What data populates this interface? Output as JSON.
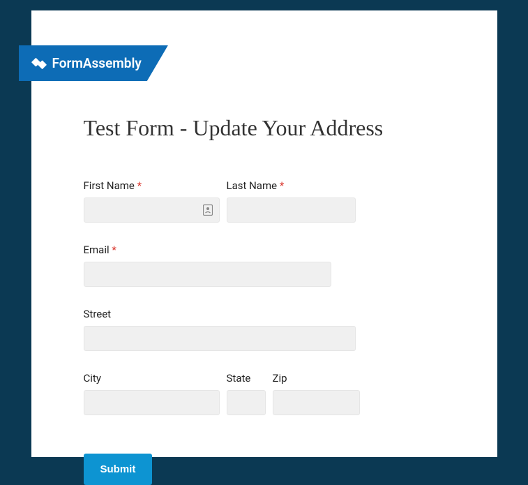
{
  "brand": {
    "name": "FormAssembly"
  },
  "title": "Test Form - Update Your Address",
  "fields": {
    "first_name": {
      "label": "First Name",
      "required": true
    },
    "last_name": {
      "label": "Last Name",
      "required": true
    },
    "email": {
      "label": "Email",
      "required": true
    },
    "street": {
      "label": "Street",
      "required": false
    },
    "city": {
      "label": "City",
      "required": false
    },
    "state": {
      "label": "State",
      "required": false
    },
    "zip": {
      "label": "Zip",
      "required": false
    }
  },
  "required_marker": "*",
  "submit_label": "Submit"
}
